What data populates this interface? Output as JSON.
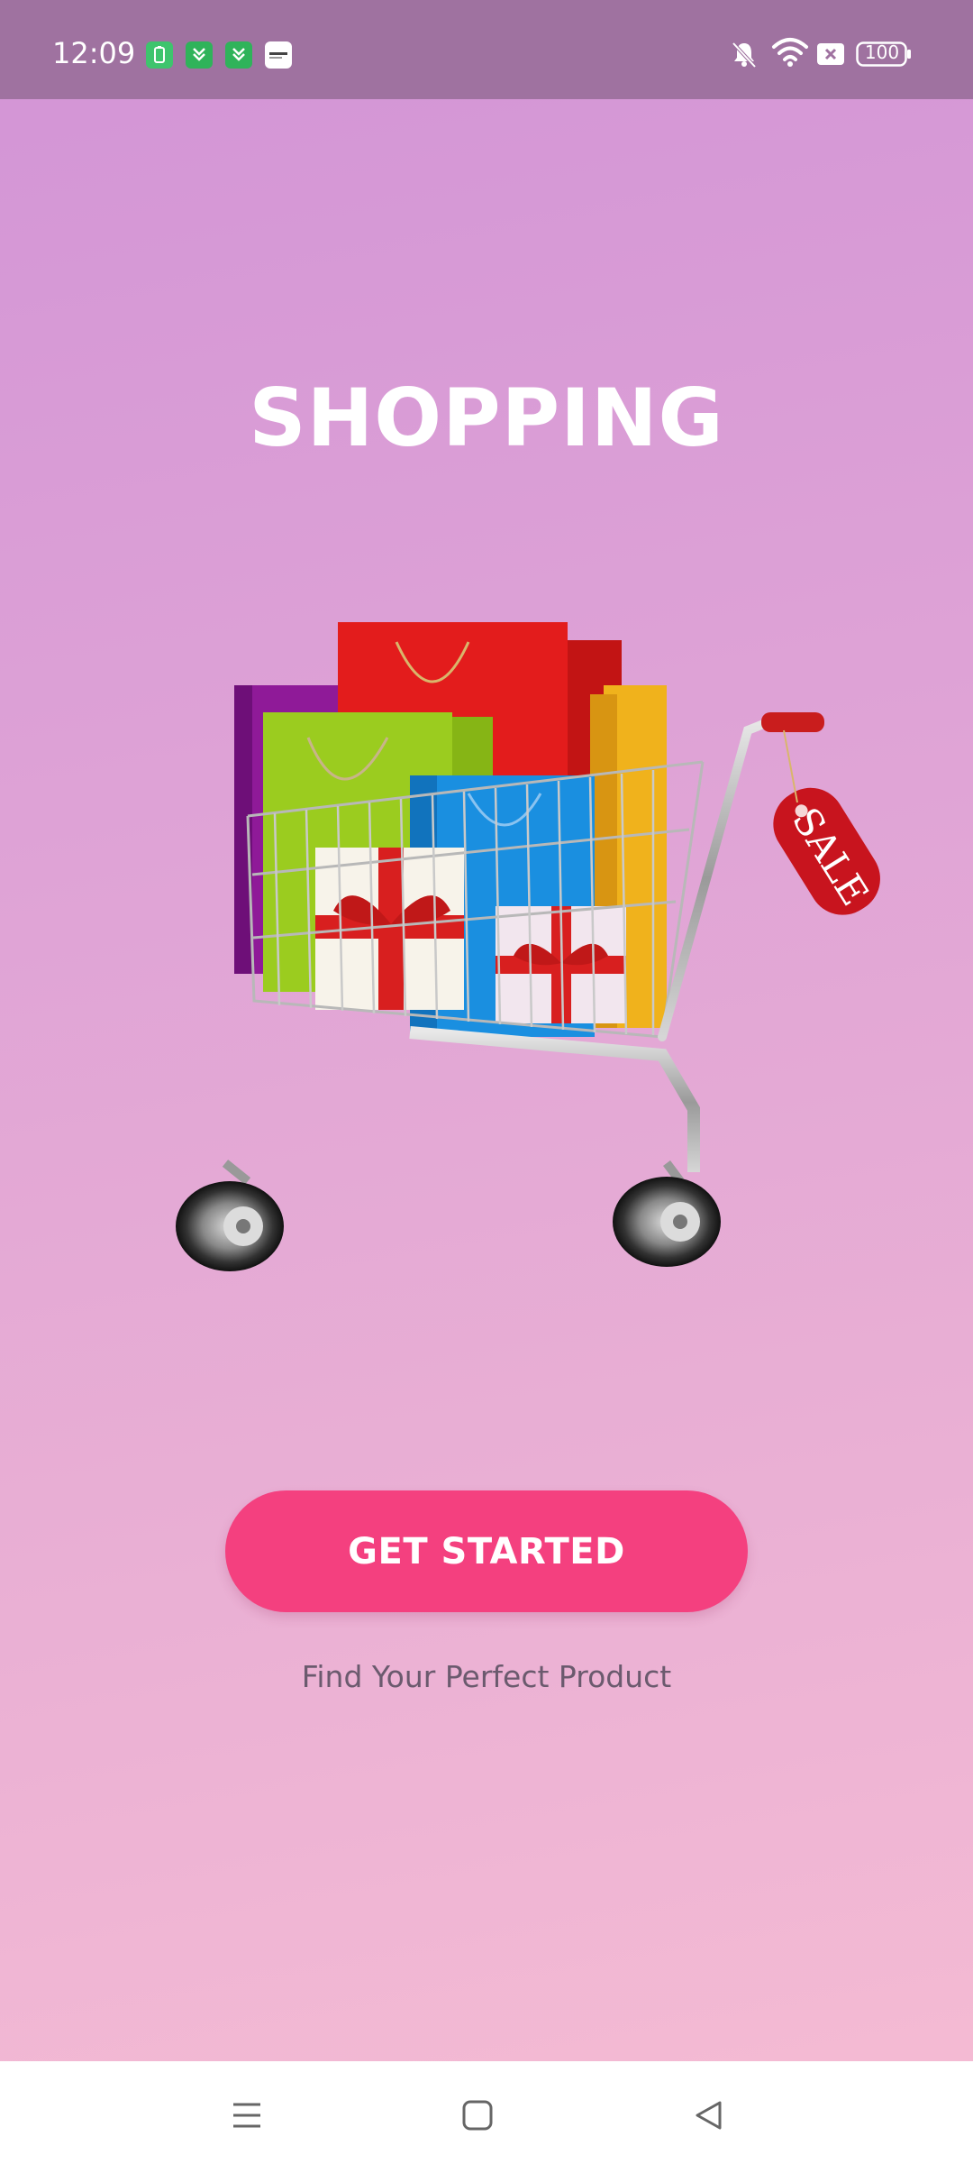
{
  "status_bar": {
    "time": "12:09",
    "battery_level": "100",
    "notification_icons": [
      "battery-saver-icon",
      "app-icon",
      "app-icon",
      "news-app-icon"
    ],
    "right_icons": [
      "silent-bell-icon",
      "wifi-icon",
      "x-box-icon",
      "battery-icon"
    ],
    "color": "#9f72a0"
  },
  "main": {
    "title": "SHOPPING",
    "illustration": "shopping-cart-with-bags-and-sale-tag",
    "sale_tag_text": "SALE",
    "cta_label": "GET STARTED",
    "tagline": "Find Your Perfect Product"
  },
  "nav_bar": {
    "buttons": [
      "menu-icon",
      "home-icon",
      "back-icon"
    ]
  },
  "colors": {
    "accent": "#f4407f",
    "background_top": "#d294d6",
    "background_bottom": "#f6bcd3"
  }
}
